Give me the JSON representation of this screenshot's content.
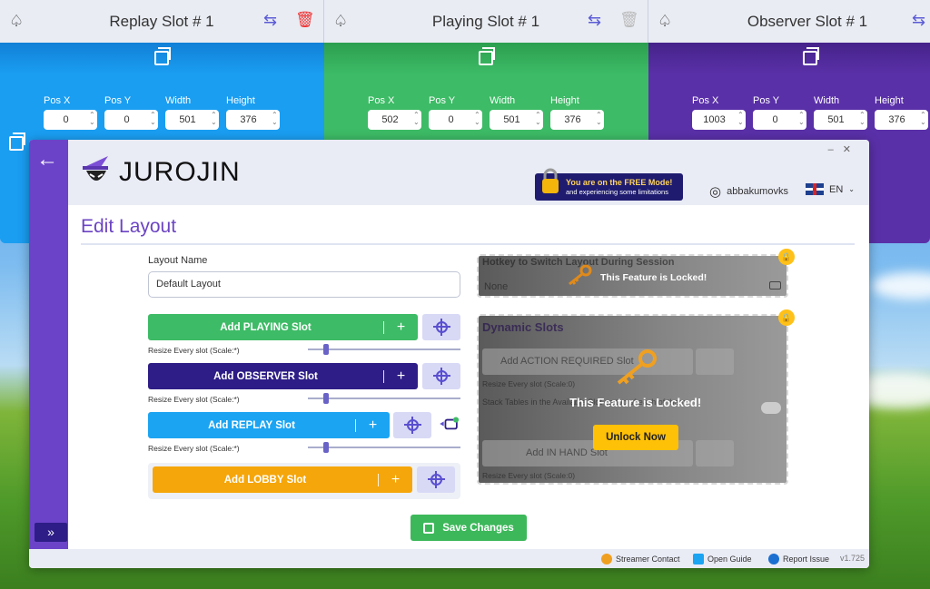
{
  "windows": [
    {
      "title": "Replay Slot # 1",
      "color": "#1a9ef2",
      "dark": "#1180d6",
      "fields": [
        {
          "label": "Pos X",
          "value": "0"
        },
        {
          "label": "Pos Y",
          "value": "0"
        },
        {
          "label": "Width",
          "value": "501"
        },
        {
          "label": "Height",
          "value": "376"
        }
      ]
    },
    {
      "title": "Playing Slot # 1",
      "color": "#3dbb66",
      "dark": "#2c9f4f",
      "fields": [
        {
          "label": "Pos X",
          "value": "502"
        },
        {
          "label": "Pos Y",
          "value": "0"
        },
        {
          "label": "Width",
          "value": "501"
        },
        {
          "label": "Height",
          "value": "376"
        }
      ]
    },
    {
      "title": "Observer Slot # 1",
      "color": "#5a30a8",
      "dark": "#45238a",
      "fields": [
        {
          "label": "Pos X",
          "value": "1003"
        },
        {
          "label": "Pos Y",
          "value": "0"
        },
        {
          "label": "Width",
          "value": "501"
        },
        {
          "label": "Height",
          "value": "376"
        }
      ]
    }
  ],
  "app": {
    "brand": "JUROJIN",
    "free_mode_line1": "You are on the FREE Mode!",
    "free_mode_line2": "and experiencing some limitations",
    "username": "abbakumovks",
    "language": "EN",
    "page_title": "Edit Layout",
    "layout_name_label": "Layout Name",
    "layout_name_value": "Default Layout",
    "add_playing": "Add PLAYING Slot",
    "add_observer": "Add OBSERVER Slot",
    "add_replay": "Add REPLAY Slot",
    "add_lobby": "Add LOBBY Slot",
    "resize_label": "Resize Every slot (Scale:*)",
    "hotkey_label": "Hotkey to Switch Layout During Session",
    "hotkey_value": "None",
    "locked_text": "This Feature is Locked!",
    "dynamic_slots": "Dynamic Slots",
    "add_action_required": "Add ACTION REQUIRED Slot",
    "resize_label_zero": "Resize Every slot (Scale:0)",
    "stack_tables": "Stack Tables in the Available Slot on top of each of them",
    "add_in_hand": "Add IN HAND Slot",
    "unlock_now": "Unlock Now",
    "save_changes": "Save Changes",
    "footer": {
      "streamer_contact": "Streamer Contact",
      "open_guide": "Open Guide",
      "report_issue": "Report Issue",
      "version": "v1.725"
    }
  },
  "colors": {
    "playing": "#3dbb66",
    "observer": "#2e1d86",
    "replay": "#1ba4f2",
    "lobby": "#f5a60a",
    "accent": "#6c44c4"
  },
  "icons": [
    "spade-icon",
    "swap-icon",
    "trash-icon",
    "copy-icon",
    "back-arrow-icon",
    "wizard-hat-icon",
    "lock-icon",
    "user-icon",
    "uk-flag-icon",
    "crosshair-icon",
    "monitor-icon",
    "key-icon",
    "save-icon",
    "expand-icon",
    "chevron-down-icon"
  ]
}
